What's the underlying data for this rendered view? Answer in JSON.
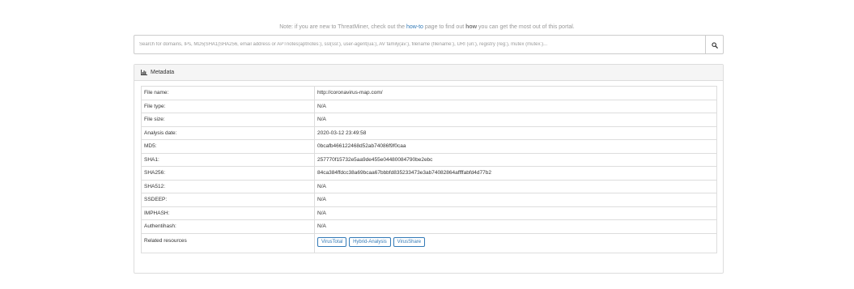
{
  "note": {
    "prefix": "Note: if you are new to ThreatMiner, check out the ",
    "link": "how-to",
    "middle": " page to find out ",
    "bold": "how",
    "suffix": " you can get the most out of this portal."
  },
  "search": {
    "placeholder": "Search for domains, IPs, MD5|SHA1|SHA256, email address or APTnotes(aptnotes:), ssl(ssl:), user-agent(ua:), AV family(av:), filename (filename:), URI (uri:), registry (reg:), mutex (mutex:)...",
    "icon": "search-icon"
  },
  "panel": {
    "title": "Metadata",
    "icon": "bar-chart-icon"
  },
  "rows": [
    {
      "label": "File name:",
      "value": "http://coronavirus-map.com/"
    },
    {
      "label": "File type:",
      "value": "N/A"
    },
    {
      "label": "File size:",
      "value": "N/A"
    },
    {
      "label": "Analysis date:",
      "value": "2020-03-12 23:49:58"
    },
    {
      "label": "MD5:",
      "value": "0bcafb466122468d52ab74086f9f0caa"
    },
    {
      "label": "SHA1:",
      "value": "257770f15732e5aa9de455e04480084790be2ebc"
    },
    {
      "label": "SHA256:",
      "value": "84ca384ffdcc38a69bcaa67bbbfd835233473e3ab74082864affffabfd4d77b2"
    },
    {
      "label": "SHA512:",
      "value": "N/A"
    },
    {
      "label": "SSDEEP:",
      "value": "N/A"
    },
    {
      "label": "IMPHASH:",
      "value": "N/A"
    },
    {
      "label": "Authentihash:",
      "value": "N/A"
    }
  ],
  "related": {
    "label": "Related resources",
    "buttons": [
      "VirusTotal",
      "Hybrid-Analysis",
      "VirusShare"
    ]
  },
  "colors": {
    "link": "#337ab7",
    "border": "#dddddd",
    "heading_bg": "#f5f5f5"
  }
}
